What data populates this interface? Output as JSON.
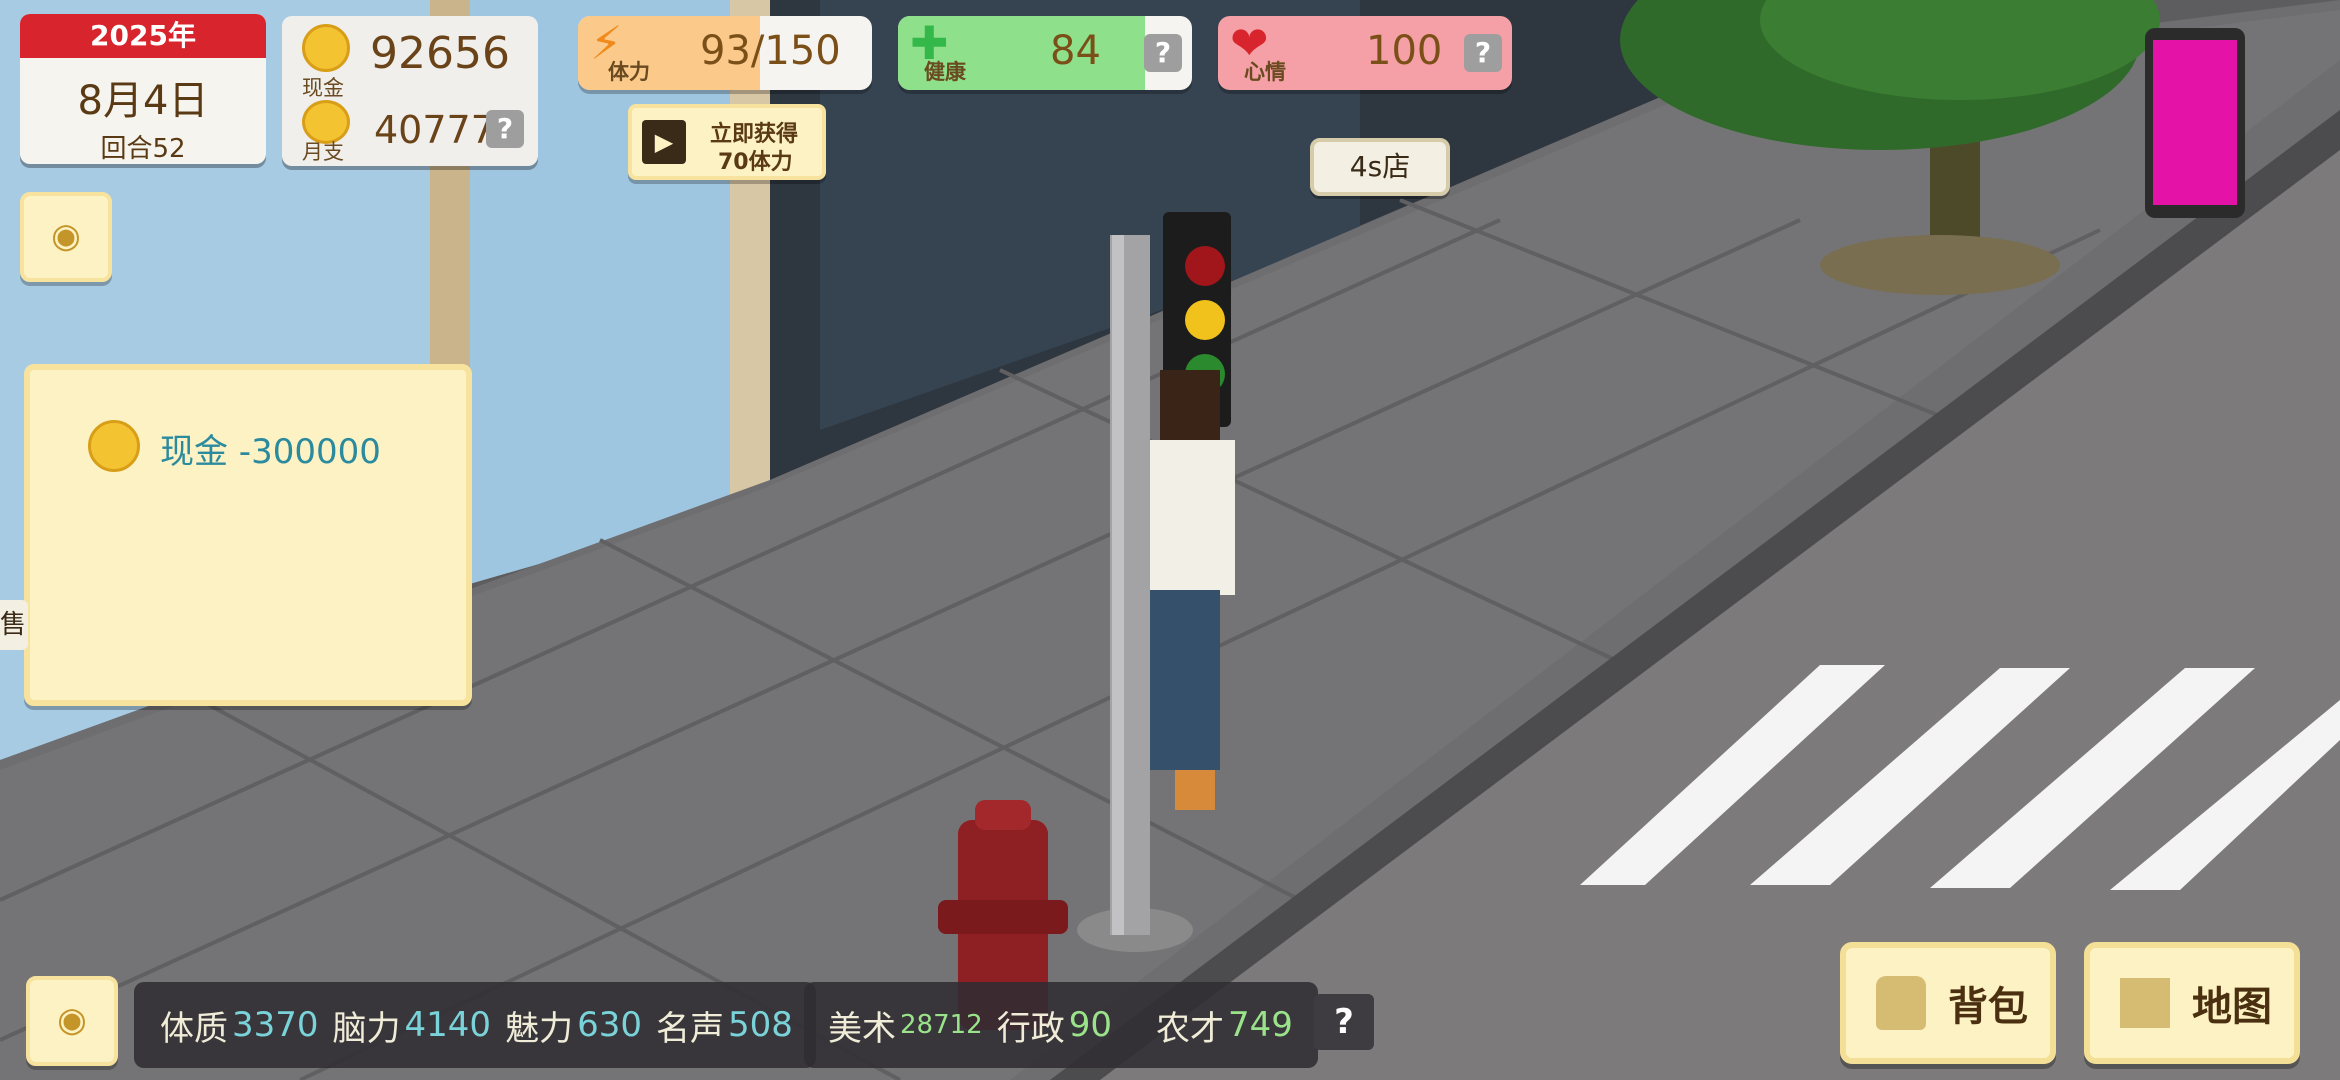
{
  "date_panel": {
    "year": "2025年",
    "date": "8月4日",
    "round": "回合52"
  },
  "money_panel": {
    "cash_label": "现金",
    "cash_value": "92656",
    "monthly_label": "月支",
    "monthly_value": "40777",
    "help": "?"
  },
  "stamina": {
    "label": "体力",
    "value": "93/150",
    "icon": "lightning-icon"
  },
  "health": {
    "label": "健康",
    "value": "84",
    "icon": "plus-icon",
    "help": "?"
  },
  "mood": {
    "label": "心情",
    "value": "100",
    "icon": "heart-icon",
    "help": "?"
  },
  "ad_button": {
    "line1": "立即获得",
    "line2": "70体力",
    "icon": "film-icon"
  },
  "location_tag": "4s店",
  "notification": {
    "text": "现金 -300000"
  },
  "shop_sign_char": "售",
  "bottom_stats_1": [
    {
      "label": "体质",
      "value": "3370"
    },
    {
      "label": "脑力",
      "value": "4140"
    },
    {
      "label": "魅力",
      "value": "630"
    },
    {
      "label": "名声",
      "value": "508"
    }
  ],
  "bottom_stats_2": [
    {
      "label": "美术",
      "value": "28712"
    },
    {
      "label": "行政",
      "value": "90"
    },
    {
      "label": "农才",
      "value": "749"
    }
  ],
  "bottom_help": "?",
  "buttons": {
    "bag": "背包",
    "map": "地图"
  },
  "colors": {
    "stamina": "#fbc98a",
    "health": "#8fe08a",
    "mood": "#f5a0a6",
    "cream": "#fdf2c4",
    "calendar_red": "#d8242c"
  }
}
